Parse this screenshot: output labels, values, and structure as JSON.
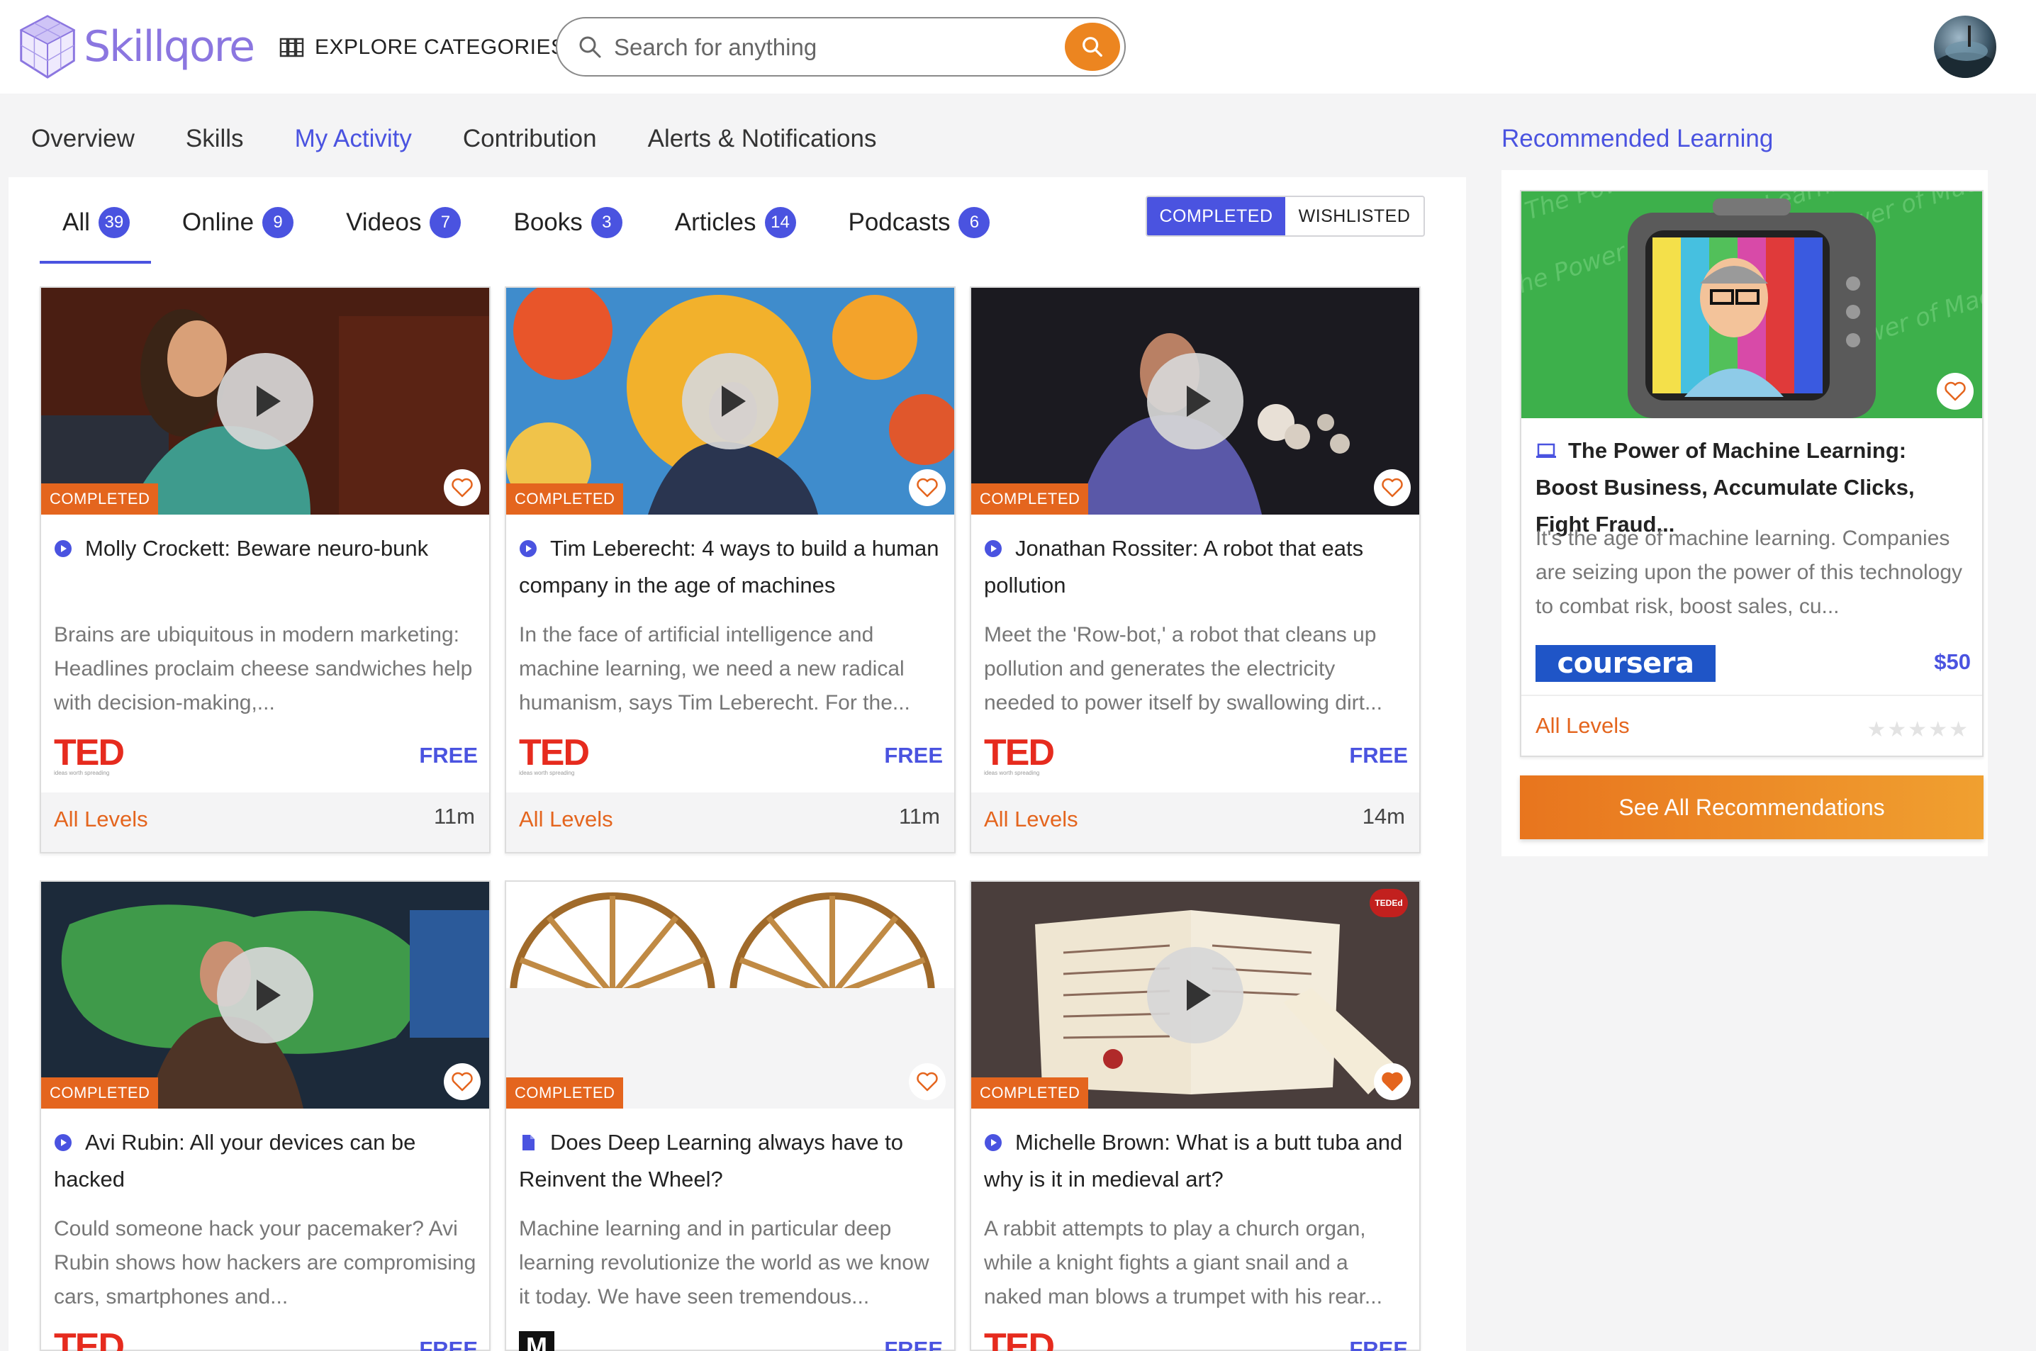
{
  "header": {
    "brand": "Skillqore",
    "explore_label": "EXPLORE CATEGORIES",
    "search_placeholder": "Search for anything"
  },
  "main_tabs": [
    {
      "label": "Overview",
      "active": false
    },
    {
      "label": "Skills",
      "active": false
    },
    {
      "label": "My Activity",
      "active": true
    },
    {
      "label": "Contribution",
      "active": false
    },
    {
      "label": "Alerts & Notifications",
      "active": false
    }
  ],
  "sub_tabs": [
    {
      "label": "All",
      "count": "39",
      "active": true
    },
    {
      "label": "Online",
      "count": "9",
      "active": false
    },
    {
      "label": "Videos",
      "count": "7",
      "active": false
    },
    {
      "label": "Books",
      "count": "3",
      "active": false
    },
    {
      "label": "Articles",
      "count": "14",
      "active": false
    },
    {
      "label": "Podcasts",
      "count": "6",
      "active": false
    }
  ],
  "toggle": {
    "completed": "COMPLETED",
    "wishlisted": "WISHLISTED",
    "selected": "completed"
  },
  "cards": [
    {
      "title": "Molly Crockett: Beware neuro-bunk",
      "type_icon": "play-circle-icon",
      "desc": "Brains are ubiquitous in modern marketing: Headlines proclaim cheese sandwiches help with decision-making,...",
      "status": "COMPLETED",
      "provider": "TED",
      "provider_sub": "ideas worth spreading",
      "price": "FREE",
      "level": "All Levels",
      "duration": "11m",
      "wishlisted": false
    },
    {
      "title": "Tim Leberecht: 4 ways to build a human company in the age of machines",
      "type_icon": "play-circle-icon",
      "desc": "In the face of artificial intelligence and machine learning, we need a new radical humanism, says Tim Leberecht. For the...",
      "status": "COMPLETED",
      "provider": "TED",
      "provider_sub": "ideas worth spreading",
      "price": "FREE",
      "level": "All Levels",
      "duration": "11m",
      "wishlisted": false
    },
    {
      "title": "Jonathan Rossiter: A robot that eats pollution",
      "type_icon": "play-circle-icon",
      "desc": "Meet the 'Row-bot,' a robot that cleans up pollution and generates the electricity needed to power itself by swallowing dirt...",
      "status": "COMPLETED",
      "provider": "TED",
      "provider_sub": "ideas worth spreading",
      "price": "FREE",
      "level": "All Levels",
      "duration": "14m",
      "wishlisted": false
    },
    {
      "title": "Avi Rubin: All your devices can be hacked",
      "type_icon": "play-circle-icon",
      "desc": "Could someone hack your pacemaker? Avi Rubin shows how hackers are compromising cars, smartphones and...",
      "status": "COMPLETED",
      "provider": "TED",
      "provider_sub": "",
      "price": "FREE",
      "level": "",
      "duration": "",
      "wishlisted": false
    },
    {
      "title": "Does Deep Learning always have to Reinvent the Wheel?",
      "type_icon": "document-icon",
      "desc": "Machine learning and in particular deep learning revolutionize the world as we know it today. We have seen tremendous...",
      "status": "COMPLETED",
      "provider": "M",
      "provider_sub": "",
      "price": "FREE",
      "level": "",
      "duration": "",
      "wishlisted": false
    },
    {
      "title": "Michelle Brown: What is a butt tuba and why is it in medieval art?",
      "type_icon": "play-circle-icon",
      "desc": "A rabbit attempts to play a church organ, while a knight fights a giant snail and a naked man blows a trumpet with his rear...",
      "status": "COMPLETED",
      "provider": "TED",
      "provider_sub": "",
      "price": "FREE",
      "level": "",
      "duration": "",
      "wishlisted": true,
      "corner_badge": "TEDEd"
    }
  ],
  "recommended": {
    "heading": "Recommended Learning",
    "title": "The Power of Machine Learning: Boost Business, Accumulate Clicks, Fight Fraud...",
    "type_icon": "laptop-icon",
    "desc": "It's the age of machine learning. Companies are seizing upon the power of this technology to combat risk, boost sales, cu...",
    "provider": "coursera",
    "price": "$50",
    "level": "All Levels",
    "rating": 0,
    "rating_max": 5,
    "see_all": "See All Recommendations",
    "thumb_text": "The Power of Machine Learning"
  },
  "colors": {
    "accent": "#4a53e0",
    "orange": "#e4651e",
    "ted_red": "#e62b1e",
    "coursera_blue": "#1f55c7"
  }
}
